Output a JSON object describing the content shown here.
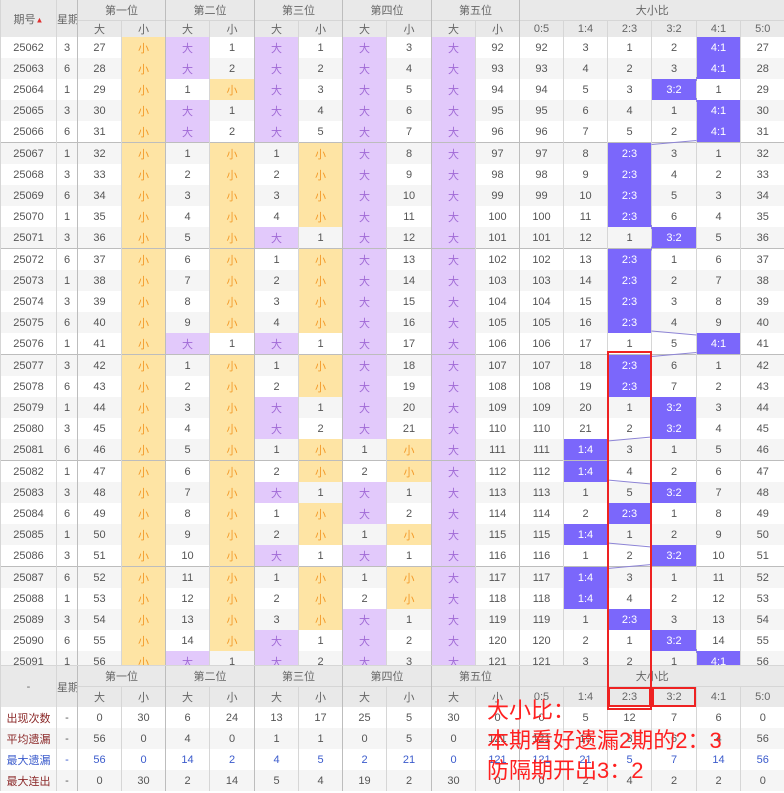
{
  "header": {
    "issue": "期号",
    "weekday": "星期",
    "positions": [
      "第一位",
      "第二位",
      "第三位",
      "第四位",
      "第五位"
    ],
    "big": "大",
    "small": "小",
    "ratio_group": "大小比",
    "ratios": [
      "0:5",
      "1:4",
      "2:3",
      "3:2",
      "4:1",
      "5:0"
    ]
  },
  "rows": [
    {
      "issue": "25062",
      "week": "3",
      "cells": [
        "27",
        "小",
        "大",
        "1",
        "大",
        "1",
        "大",
        "3",
        "大",
        "92",
        "92",
        "3",
        "1",
        "2",
        "4:1",
        "27"
      ]
    },
    {
      "issue": "25063",
      "week": "6",
      "cells": [
        "28",
        "小",
        "大",
        "2",
        "大",
        "2",
        "大",
        "4",
        "大",
        "93",
        "93",
        "4",
        "2",
        "3",
        "4:1",
        "28"
      ]
    },
    {
      "issue": "25064",
      "week": "1",
      "cells": [
        "29",
        "小",
        "1",
        "小",
        "大",
        "3",
        "大",
        "5",
        "大",
        "94",
        "94",
        "5",
        "3",
        "3:2",
        "1",
        "29"
      ]
    },
    {
      "issue": "25065",
      "week": "3",
      "cells": [
        "30",
        "小",
        "大",
        "1",
        "大",
        "4",
        "大",
        "6",
        "大",
        "95",
        "95",
        "6",
        "4",
        "1",
        "4:1",
        "30"
      ]
    },
    {
      "issue": "25066",
      "week": "6",
      "cells": [
        "31",
        "小",
        "大",
        "2",
        "大",
        "5",
        "大",
        "7",
        "大",
        "96",
        "96",
        "7",
        "5",
        "2",
        "4:1",
        "31"
      ]
    },
    {
      "issue": "25067",
      "week": "1",
      "cells": [
        "32",
        "小",
        "1",
        "小",
        "1",
        "小",
        "大",
        "8",
        "大",
        "97",
        "97",
        "8",
        "2:3",
        "3",
        "1",
        "32"
      ]
    },
    {
      "issue": "25068",
      "week": "3",
      "cells": [
        "33",
        "小",
        "2",
        "小",
        "2",
        "小",
        "大",
        "9",
        "大",
        "98",
        "98",
        "9",
        "2:3",
        "4",
        "2",
        "33"
      ]
    },
    {
      "issue": "25069",
      "week": "6",
      "cells": [
        "34",
        "小",
        "3",
        "小",
        "3",
        "小",
        "大",
        "10",
        "大",
        "99",
        "99",
        "10",
        "2:3",
        "5",
        "3",
        "34"
      ]
    },
    {
      "issue": "25070",
      "week": "1",
      "cells": [
        "35",
        "小",
        "4",
        "小",
        "4",
        "小",
        "大",
        "11",
        "大",
        "100",
        "100",
        "11",
        "2:3",
        "6",
        "4",
        "35"
      ]
    },
    {
      "issue": "25071",
      "week": "3",
      "cells": [
        "36",
        "小",
        "5",
        "小",
        "大",
        "1",
        "大",
        "12",
        "大",
        "101",
        "101",
        "12",
        "1",
        "3:2",
        "5",
        "36"
      ]
    },
    {
      "issue": "25072",
      "week": "6",
      "cells": [
        "37",
        "小",
        "6",
        "小",
        "1",
        "小",
        "大",
        "13",
        "大",
        "102",
        "102",
        "13",
        "2:3",
        "1",
        "6",
        "37"
      ]
    },
    {
      "issue": "25073",
      "week": "1",
      "cells": [
        "38",
        "小",
        "7",
        "小",
        "2",
        "小",
        "大",
        "14",
        "大",
        "103",
        "103",
        "14",
        "2:3",
        "2",
        "7",
        "38"
      ]
    },
    {
      "issue": "25074",
      "week": "3",
      "cells": [
        "39",
        "小",
        "8",
        "小",
        "3",
        "小",
        "大",
        "15",
        "大",
        "104",
        "104",
        "15",
        "2:3",
        "3",
        "8",
        "39"
      ]
    },
    {
      "issue": "25075",
      "week": "6",
      "cells": [
        "40",
        "小",
        "9",
        "小",
        "4",
        "小",
        "大",
        "16",
        "大",
        "105",
        "105",
        "16",
        "2:3",
        "4",
        "9",
        "40"
      ]
    },
    {
      "issue": "25076",
      "week": "1",
      "cells": [
        "41",
        "小",
        "大",
        "1",
        "大",
        "1",
        "大",
        "17",
        "大",
        "106",
        "106",
        "17",
        "1",
        "5",
        "4:1",
        "41"
      ]
    },
    {
      "issue": "25077",
      "week": "3",
      "cells": [
        "42",
        "小",
        "1",
        "小",
        "1",
        "小",
        "大",
        "18",
        "大",
        "107",
        "107",
        "18",
        "2:3",
        "6",
        "1",
        "42"
      ]
    },
    {
      "issue": "25078",
      "week": "6",
      "cells": [
        "43",
        "小",
        "2",
        "小",
        "2",
        "小",
        "大",
        "19",
        "大",
        "108",
        "108",
        "19",
        "2:3",
        "7",
        "2",
        "43"
      ]
    },
    {
      "issue": "25079",
      "week": "1",
      "cells": [
        "44",
        "小",
        "3",
        "小",
        "大",
        "1",
        "大",
        "20",
        "大",
        "109",
        "109",
        "20",
        "1",
        "3:2",
        "3",
        "44"
      ]
    },
    {
      "issue": "25080",
      "week": "3",
      "cells": [
        "45",
        "小",
        "4",
        "小",
        "大",
        "2",
        "大",
        "21",
        "大",
        "110",
        "110",
        "21",
        "2",
        "3:2",
        "4",
        "45"
      ]
    },
    {
      "issue": "25081",
      "week": "6",
      "cells": [
        "46",
        "小",
        "5",
        "小",
        "1",
        "小",
        "1",
        "小",
        "大",
        "111",
        "111",
        "1:4",
        "3",
        "1",
        "5",
        "46"
      ]
    },
    {
      "issue": "25082",
      "week": "1",
      "cells": [
        "47",
        "小",
        "6",
        "小",
        "2",
        "小",
        "2",
        "小",
        "大",
        "112",
        "112",
        "1:4",
        "4",
        "2",
        "6",
        "47"
      ]
    },
    {
      "issue": "25083",
      "week": "3",
      "cells": [
        "48",
        "小",
        "7",
        "小",
        "大",
        "1",
        "大",
        "1",
        "大",
        "113",
        "113",
        "1",
        "5",
        "3:2",
        "7",
        "48"
      ]
    },
    {
      "issue": "25084",
      "week": "6",
      "cells": [
        "49",
        "小",
        "8",
        "小",
        "1",
        "小",
        "大",
        "2",
        "大",
        "114",
        "114",
        "2",
        "2:3",
        "1",
        "8",
        "49"
      ]
    },
    {
      "issue": "25085",
      "week": "1",
      "cells": [
        "50",
        "小",
        "9",
        "小",
        "2",
        "小",
        "1",
        "小",
        "大",
        "115",
        "115",
        "1:4",
        "1",
        "2",
        "9",
        "50"
      ]
    },
    {
      "issue": "25086",
      "week": "3",
      "cells": [
        "51",
        "小",
        "10",
        "小",
        "大",
        "1",
        "大",
        "1",
        "大",
        "116",
        "116",
        "1",
        "2",
        "3:2",
        "10",
        "51"
      ]
    },
    {
      "issue": "25087",
      "week": "6",
      "cells": [
        "52",
        "小",
        "11",
        "小",
        "1",
        "小",
        "1",
        "小",
        "大",
        "117",
        "117",
        "1:4",
        "3",
        "1",
        "11",
        "52"
      ]
    },
    {
      "issue": "25088",
      "week": "1",
      "cells": [
        "53",
        "小",
        "12",
        "小",
        "2",
        "小",
        "2",
        "小",
        "大",
        "118",
        "118",
        "1:4",
        "4",
        "2",
        "12",
        "53"
      ]
    },
    {
      "issue": "25089",
      "week": "3",
      "cells": [
        "54",
        "小",
        "13",
        "小",
        "3",
        "小",
        "大",
        "1",
        "大",
        "119",
        "119",
        "1",
        "2:3",
        "3",
        "13",
        "54"
      ]
    },
    {
      "issue": "25090",
      "week": "6",
      "cells": [
        "55",
        "小",
        "14",
        "小",
        "大",
        "1",
        "大",
        "2",
        "大",
        "120",
        "120",
        "2",
        "1",
        "3:2",
        "14",
        "55"
      ]
    },
    {
      "issue": "25091",
      "week": "1",
      "cells": [
        "56",
        "小",
        "大",
        "1",
        "大",
        "2",
        "大",
        "3",
        "大",
        "121",
        "121",
        "3",
        "2",
        "1",
        "4:1",
        "56"
      ]
    }
  ],
  "footer": {
    "dash": "-",
    "stats": [
      {
        "label": "出现次数",
        "week": "-",
        "values": [
          "0",
          "30",
          "6",
          "24",
          "13",
          "17",
          "25",
          "5",
          "30",
          "0",
          "0",
          "5",
          "12",
          "7",
          "6",
          "0"
        ]
      },
      {
        "label": "平均遗漏",
        "week": "-",
        "values": [
          "56",
          "0",
          "4",
          "0",
          "1",
          "1",
          "0",
          "5",
          "0",
          "121",
          "121",
          "19",
          "3",
          "6",
          "4",
          "56"
        ]
      },
      {
        "label": "最大遗漏",
        "week": "-",
        "values": [
          "56",
          "0",
          "14",
          "2",
          "4",
          "5",
          "2",
          "21",
          "0",
          "121",
          "121",
          "21",
          "5",
          "7",
          "14",
          "56"
        ]
      },
      {
        "label": "最大连出",
        "week": "-",
        "values": [
          "0",
          "30",
          "2",
          "14",
          "5",
          "4",
          "19",
          "2",
          "30",
          "0",
          "0",
          "2",
          "4",
          "2",
          "2",
          "0"
        ]
      }
    ]
  },
  "annotation": {
    "line1": "大小比：",
    "line2": "本期看好遗漏2期的2：3",
    "line3": "防隔期开出3：2"
  },
  "colors": {
    "big_bg": "#e2c9fb",
    "small_bg": "#fee4a4",
    "hit_bg": "#7b67fb",
    "annotation": "#ff2020"
  }
}
